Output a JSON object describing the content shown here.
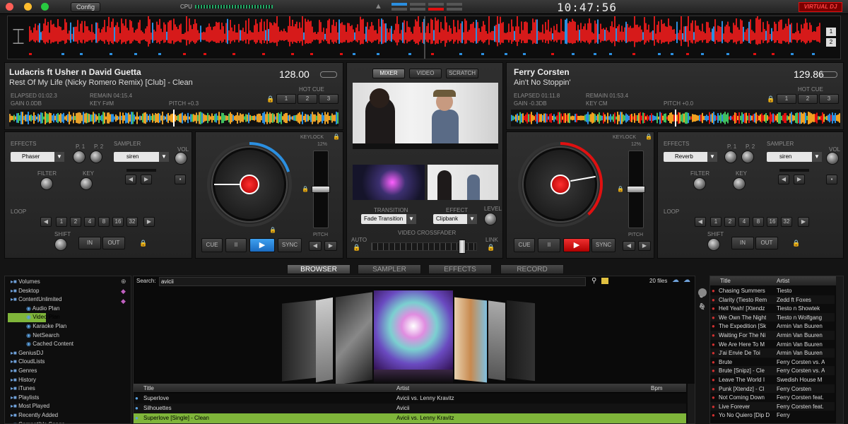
{
  "top": {
    "config_label": "Config",
    "cpu_label": "CPU",
    "clock": "10:47:56",
    "logo": "VIRTUAL DJ"
  },
  "deck_left": {
    "artist": "Ludacris ft Usher n David Guetta",
    "title": "Rest Of My Life (Nicky Romero Remix) [Club] - Clean",
    "bpm": "128.00",
    "elapsed": "ELAPSED 01:02.3",
    "remain": "REMAIN 04:15.4",
    "gain": "GAIN 0.0dB",
    "key": "KEY F#m",
    "pitch": "PITCH +0.3",
    "hot_cue": "HOT CUE",
    "hotcues": [
      "1",
      "2",
      "3"
    ],
    "effects_label": "EFFECTS",
    "effect": "Phaser",
    "p1": "P. 1",
    "p2": "P. 2",
    "sampler_label": "SAMPLER",
    "sampler": "siren",
    "vol": "VOL",
    "filter": "FILTER",
    "keylabel": "KEY",
    "loop": "LOOP",
    "loop_values": [
      "1",
      "2",
      "4",
      "8",
      "16",
      "32"
    ],
    "shift": "SHIFT",
    "in": "IN",
    "out": "OUT",
    "cue": "CUE",
    "pause": "II",
    "play": "▶",
    "sync": "SYNC",
    "keylock": "KEYLOCK",
    "pitch_range": "12%",
    "pitch_bend": "PITCH"
  },
  "deck_right": {
    "artist": "Ferry Corsten",
    "title": "Ain't No Stoppin'",
    "bpm": "129.86",
    "elapsed": "ELAPSED 01:11.8",
    "remain": "REMAIN 01:53.4",
    "gain": "GAIN -0.3dB",
    "key": "KEY Cm",
    "pitch": "PITCH +0.0",
    "hot_cue": "HOT CUE",
    "hotcues": [
      "1",
      "2",
      "3"
    ],
    "effects_label": "EFFECTS",
    "effect": "Reverb",
    "p1": "P. 1",
    "p2": "P. 2",
    "sampler_label": "SAMPLER",
    "sampler": "siren",
    "vol": "VOL",
    "filter": "FILTER",
    "keylabel": "KEY",
    "loop": "LOOP",
    "loop_values": [
      "1",
      "2",
      "4",
      "8",
      "16",
      "32"
    ],
    "shift": "SHIFT",
    "in": "IN",
    "out": "OUT",
    "cue": "CUE",
    "pause": "II",
    "play": "▶",
    "sync": "SYNC",
    "keylock": "KEYLOCK",
    "pitch_range": "12%",
    "pitch_bend": "PITCH"
  },
  "center": {
    "modes": [
      "MIXER",
      "VIDEO",
      "SCRATCH"
    ],
    "transition_label": "TRANSITION",
    "transition": "Fade Transition",
    "effect_label": "EFFECT",
    "effect": "Clipbank",
    "level": "LEVEL",
    "crossfader_label": "VIDEO CROSSFADER",
    "auto": "AUTO",
    "link": "LINK"
  },
  "tabs": [
    "BROWSER",
    "SAMPLER",
    "EFFECTS",
    "RECORD"
  ],
  "browser": {
    "search_label": "Search:",
    "search_value": "avicii",
    "files_count": "20 files",
    "tree": [
      {
        "label": "Volumes",
        "indent": 0
      },
      {
        "label": "Desktop",
        "indent": 0
      },
      {
        "label": "ContentUnlimited",
        "indent": 0
      },
      {
        "label": "Audio Plan",
        "indent": 1
      },
      {
        "label": "Video Plan",
        "indent": 1,
        "selected": true
      },
      {
        "label": "Karaoke Plan",
        "indent": 1
      },
      {
        "label": "NetSearch",
        "indent": 1
      },
      {
        "label": "Cached Content",
        "indent": 1
      },
      {
        "label": "GeniusDJ",
        "indent": 0
      },
      {
        "label": "CloudLists",
        "indent": 0
      },
      {
        "label": "Genres",
        "indent": 0
      },
      {
        "label": "History",
        "indent": 0
      },
      {
        "label": "iTunes",
        "indent": 0
      },
      {
        "label": "Playlists",
        "indent": 0
      },
      {
        "label": "Most Played",
        "indent": 0
      },
      {
        "label": "Recently Added",
        "indent": 0
      },
      {
        "label": "Compatible Songs",
        "indent": 0
      }
    ],
    "columns": [
      "Title",
      "Artist",
      "Bpm"
    ],
    "rows": [
      {
        "title": "Superlove",
        "artist": "Avicii vs. Lenny Kravitz",
        "bpm": ""
      },
      {
        "title": "Silhouettes",
        "artist": "Avicii",
        "bpm": ""
      },
      {
        "title": "Superlove [Single] - Clean",
        "artist": "Avicii vs. Lenny Kravitz",
        "bpm": "",
        "selected": true
      }
    ]
  },
  "sidelist": {
    "columns": [
      "Title",
      "Artist"
    ],
    "rows": [
      {
        "title": "Chasing Summers",
        "artist": "Tiesto"
      },
      {
        "title": "Clarity (Tiesto Rem",
        "artist": "Zedd ft Foxes"
      },
      {
        "title": "Hell Yeah! [Xtendz",
        "artist": "Tiesto n Showtek"
      },
      {
        "title": "We Own The Night",
        "artist": "Tiesto n Wolfgang"
      },
      {
        "title": "The Expedition [Sk",
        "artist": "Armin Van Buuren"
      },
      {
        "title": "Waiting For The Ni",
        "artist": "Armin Van Buuren"
      },
      {
        "title": "We Are Here To M",
        "artist": "Armin Van Buuren"
      },
      {
        "title": "J'ai Envie De Toi",
        "artist": "Armin Van Buuren"
      },
      {
        "title": "Brute",
        "artist": "Ferry Corsten vs. A"
      },
      {
        "title": "Brute [Snipz] - Cle",
        "artist": "Ferry Corsten vs. A"
      },
      {
        "title": "Leave The World I",
        "artist": "Swedish House M"
      },
      {
        "title": "Punk [Xtendz] - Cl",
        "artist": "Ferry Corsten"
      },
      {
        "title": "Not Coming Down",
        "artist": "Ferry Corsten feat."
      },
      {
        "title": "Live Forever",
        "artist": "Ferry Corsten feat."
      },
      {
        "title": "Yo No Quiero [Dip D",
        "artist": "Ferry"
      }
    ]
  },
  "colors": {
    "accent_red": "#e01010",
    "accent_blue": "#2b8fe0",
    "wave_red": "#d61a1a",
    "select_green": "#7fb53a"
  }
}
